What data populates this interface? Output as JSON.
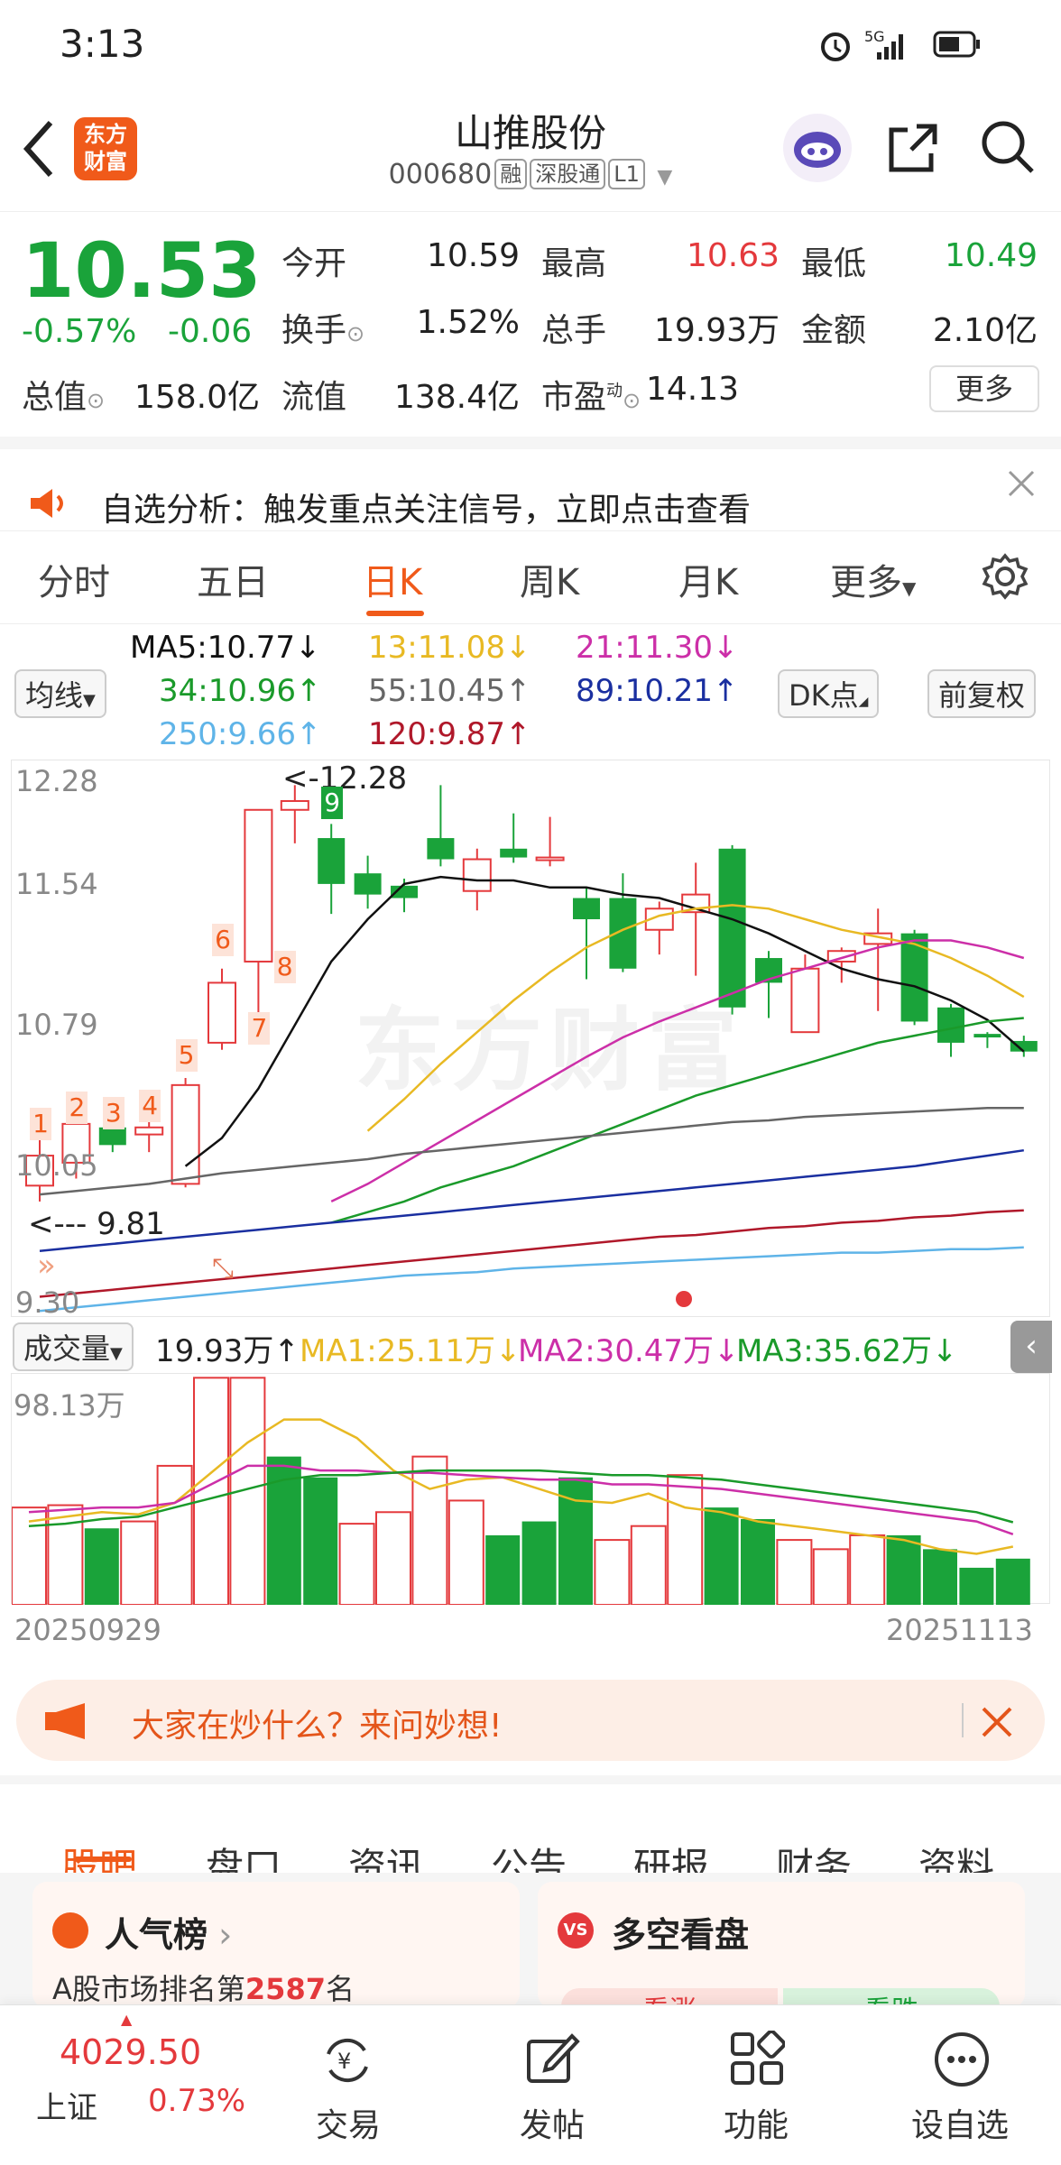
{
  "status": {
    "time": "3:13",
    "network": "5G"
  },
  "header": {
    "title": "山推股份",
    "code": "000680",
    "tags": [
      "融",
      "深股通",
      "L1"
    ],
    "logo_line1": "东方",
    "logo_line2": "财富"
  },
  "quote": {
    "price": "10.53",
    "change_pct": "-0.57%",
    "change": "-0.06",
    "open_label": "今开",
    "open": "10.59",
    "high_label": "最高",
    "high": "10.63",
    "low_label": "最低",
    "low": "10.49",
    "turnover_label": "换手",
    "turnover": "1.52%",
    "volume_label": "总手",
    "volume": "19.93万",
    "amount_label": "金额",
    "amount": "2.10亿",
    "mktcap_label": "总值",
    "mktcap": "158.0亿",
    "float_label": "流值",
    "float_cap": "138.4亿",
    "pe_label": "市盈",
    "pe_sup": "动",
    "pe": "14.13",
    "more_button": "更多"
  },
  "notice": {
    "text": "自选分析：触发重点关注信号，立即点击查看"
  },
  "period_tabs": [
    "分时",
    "五日",
    "日K",
    "周K",
    "月K",
    "更多"
  ],
  "active_period": "日K",
  "ma_legend": {
    "selector": "均线",
    "ma5": "MA5:10.77↓",
    "ma13": "13:11.08↓",
    "ma21": "21:11.30↓",
    "ma34": "34:10.96↑",
    "ma55": "55:10.45↑",
    "ma89": "89:10.21↑",
    "ma250": "250:9.66↑",
    "ma120": "120:9.87↑",
    "dk_button": "DK点",
    "adjust_button": "前复权"
  },
  "kline": {
    "y_ticks": [
      "12.28",
      "11.54",
      "10.79",
      "10.05",
      "9.30"
    ],
    "high_marker": "<-12.28",
    "low_marker": "<--- 9.81",
    "watermark": "东方财富",
    "number_tags": [
      "1",
      "2",
      "3",
      "4",
      "5",
      "6",
      "7",
      "8",
      "9"
    ]
  },
  "volume": {
    "selector": "成交量",
    "vol": "19.93万↑",
    "ma1": "MA1:25.11万↓",
    "ma2": "MA2:30.47万↓",
    "ma3": "MA3:35.62万↓",
    "y_max": "98.13万",
    "date_start": "20250929",
    "date_end": "20251113"
  },
  "ad": {
    "text": "大家在炒什么？来问妙想!"
  },
  "info_tabs": [
    "股吧",
    "盘口",
    "资讯",
    "公告",
    "研报",
    "财务",
    "资料"
  ],
  "cards": {
    "popularity_title": "人气榜",
    "popularity_text_prefix": "A股市场排名第",
    "popularity_rank": "2587",
    "popularity_text_suffix": "名",
    "bullbear_title": "多空看盘",
    "bull_label": "看涨",
    "bear_label": "看跌"
  },
  "bottom_nav": {
    "index_value": "4029.50",
    "index_name": "上证",
    "index_change": "0.73%",
    "trade": "交易",
    "post": "发帖",
    "function": "功能",
    "watchlist": "设自选"
  },
  "colors": {
    "up": "#e4393c",
    "down": "#1aa33a",
    "accent": "#f05a1a",
    "ma5": "#111111",
    "ma13": "#e8b923",
    "ma21": "#cc2fa8",
    "ma34": "#1a9a2a",
    "ma55": "#666666",
    "ma89": "#1a2fa0",
    "ma120": "#b0182a",
    "ma250": "#5fb4e8"
  }
}
